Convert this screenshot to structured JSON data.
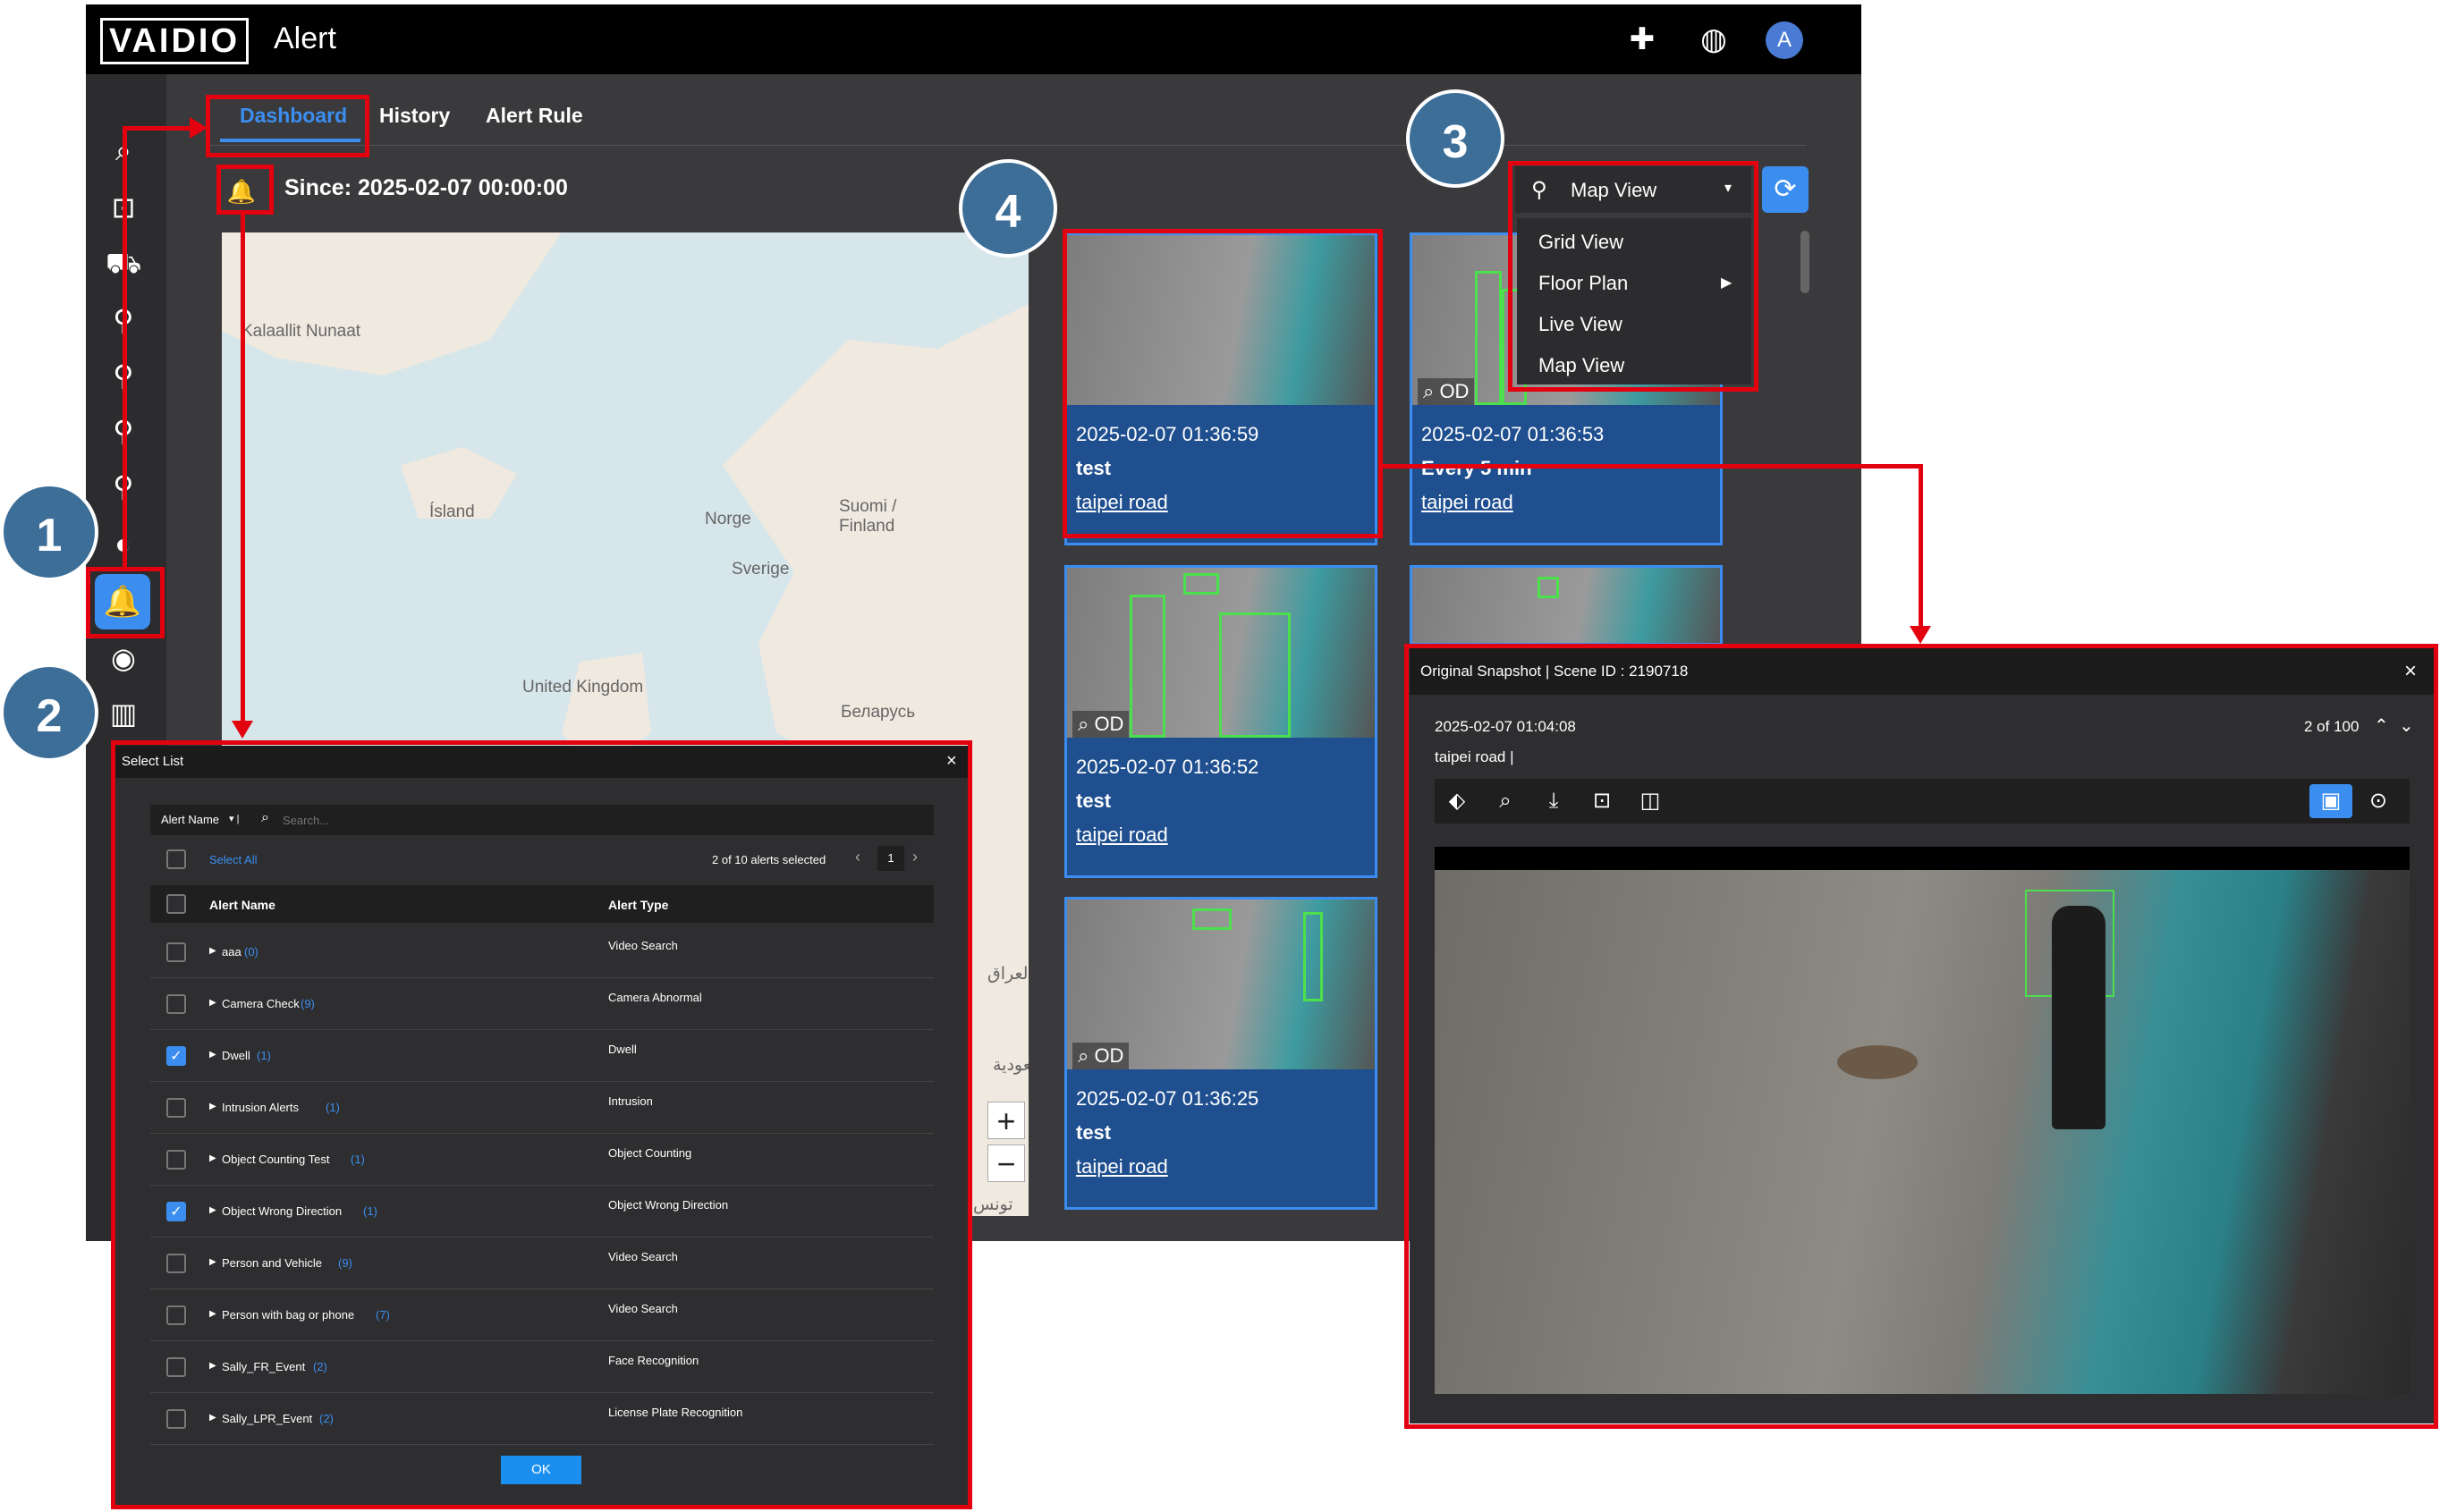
{
  "app": {
    "logo": "VAIDIO",
    "title": "Alert",
    "avatar_letter": "A",
    "tabs": [
      "Dashboard",
      "History",
      "Alert Rule"
    ],
    "since": "Since: 2025-02-07 00:00:00"
  },
  "callouts": [
    "1",
    "2",
    "3",
    "4"
  ],
  "map": {
    "labels": [
      "Kalaallit Nunaat",
      "Ísland",
      "Norge",
      "Suomi / Finland",
      "Sverige",
      "United Kingdom",
      "Беларусь",
      "العراق",
      "السعودية",
      "تونس"
    ],
    "zoom_in": "+",
    "zoom_out": "−"
  },
  "view_dropdown": {
    "selected": "Map View",
    "options": [
      "Grid View",
      "Floor Plan",
      "Live View",
      "Map View"
    ]
  },
  "cards": [
    {
      "time": "2025-02-07 01:36:59",
      "rule": "test",
      "location": "taipei road",
      "tag": ""
    },
    {
      "time": "2025-02-07 01:36:53",
      "rule": "Every 5 min",
      "location": "taipei road",
      "tag": "OD"
    },
    {
      "time": "2025-02-07 01:36:52",
      "rule": "test",
      "location": "taipei road",
      "tag": "OD"
    },
    {
      "time": "",
      "rule": "",
      "location": "",
      "tag": ""
    },
    {
      "time": "2025-02-07 01:36:25",
      "rule": "test",
      "location": "taipei road",
      "tag": "OD"
    }
  ],
  "select_list": {
    "title": "Select List",
    "filter_label": "Alert Name",
    "search_placeholder": "Search...",
    "select_all": "Select All",
    "selected_count": "2 of 10 alerts selected",
    "page": "1",
    "col_name": "Alert Name",
    "col_type": "Alert Type",
    "rows": [
      {
        "name": "aaa",
        "count": "(0)",
        "type": "Video Search",
        "checked": false
      },
      {
        "name": "Camera Check",
        "count": "(9)",
        "type": "Camera Abnormal",
        "checked": false
      },
      {
        "name": "Dwell",
        "count": "(1)",
        "type": "Dwell",
        "checked": true
      },
      {
        "name": "Intrusion Alerts",
        "count": "(1)",
        "type": "Intrusion",
        "checked": false
      },
      {
        "name": "Object Counting Test",
        "count": "(1)",
        "type": "Object Counting",
        "checked": false
      },
      {
        "name": "Object Wrong Direction",
        "count": "(1)",
        "type": "Object Wrong Direction",
        "checked": true
      },
      {
        "name": "Person and Vehicle",
        "count": "(9)",
        "type": "Video Search",
        "checked": false
      },
      {
        "name": "Person with bag or phone",
        "count": "(7)",
        "type": "Video Search",
        "checked": false
      },
      {
        "name": "Sally_FR_Event",
        "count": "(2)",
        "type": "Face Recognition",
        "checked": false
      },
      {
        "name": "Sally_LPR_Event",
        "count": "(2)",
        "type": "License Plate Recognition",
        "checked": false
      }
    ],
    "ok": "OK",
    "close": "×"
  },
  "snapshot": {
    "title": "Original Snapshot | Scene ID : 2190718",
    "time": "2025-02-07 01:04:08",
    "location": "taipei road |",
    "position": "2 of 100",
    "close": "×"
  },
  "colors": {
    "accent": "#3b8ef0",
    "annotation": "#e3000f",
    "callout": "#3c6e98",
    "card": "#1f4f8f"
  }
}
